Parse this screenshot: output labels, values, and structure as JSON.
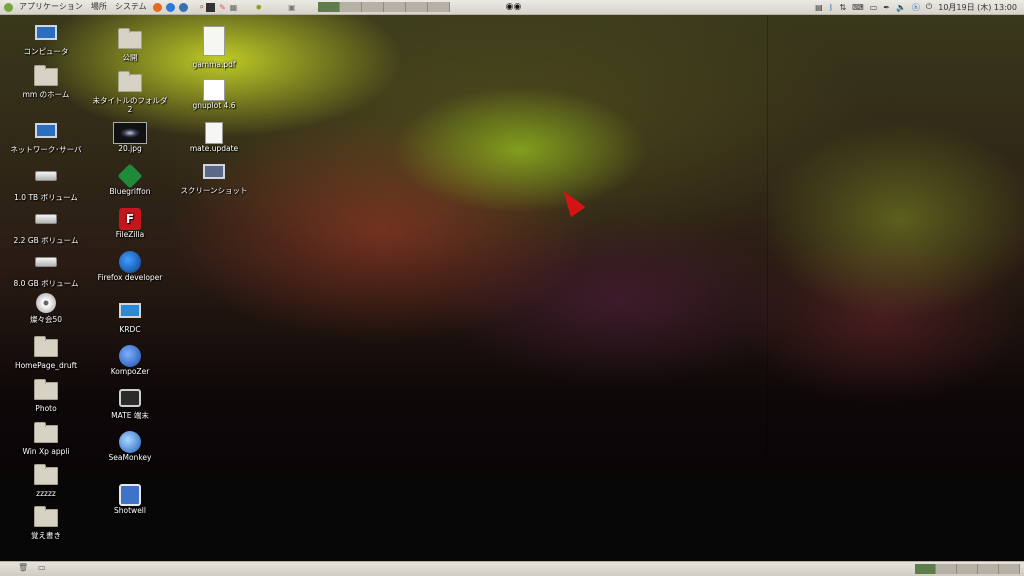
{
  "top_panel": {
    "menus": [
      "アプリケーション",
      "場所",
      "システム"
    ],
    "workspaces": 6,
    "active_workspace": 1,
    "clock": "10月19日 (木) 13:00"
  },
  "desktop": {
    "col1": [
      {
        "label": "コンピュータ",
        "icon": "computer-icon"
      },
      {
        "label": "mm のホーム",
        "icon": "home-folder-icon"
      },
      {
        "label": "ネットワーク･サーバ",
        "icon": "network-icon"
      },
      {
        "label": "1.0 TB ボリューム",
        "icon": "drive-icon"
      },
      {
        "label": "2.2 GB ボリューム",
        "icon": "drive-icon"
      },
      {
        "label": "8.0 GB ボリューム",
        "icon": "drive-icon"
      },
      {
        "label": "燦々会50",
        "icon": "disc-icon"
      },
      {
        "label": "HomePage_druft",
        "icon": "folder-icon"
      },
      {
        "label": "Photo",
        "icon": "folder-icon"
      },
      {
        "label": "Win Xp  appli",
        "icon": "folder-icon"
      },
      {
        "label": "zzzzz",
        "icon": "folder-icon"
      },
      {
        "label": "覚え書き",
        "icon": "folder-icon"
      }
    ],
    "col2": [
      {
        "label": "公開",
        "icon": "folder-icon"
      },
      {
        "label": "未タイトルのフォルダ 2",
        "icon": "folder-icon"
      },
      {
        "label": "20.jpg",
        "icon": "image-icon"
      },
      {
        "label": "Bluegriffon",
        "icon": "bluegriffon-icon"
      },
      {
        "label": "FileZilla",
        "icon": "filezilla-icon"
      },
      {
        "label": "Firefox developer",
        "icon": "firefox-icon"
      },
      {
        "label": "KRDC",
        "icon": "krdc-icon"
      },
      {
        "label": "KompoZer",
        "icon": "kompozer-icon"
      },
      {
        "label": "MATE 端末",
        "icon": "terminal-icon"
      },
      {
        "label": "SeaMonkey",
        "icon": "seamonkey-icon"
      },
      {
        "label": "Shotwell",
        "icon": "shotwell-icon"
      }
    ],
    "col3": [
      {
        "label": "gamma.pdf",
        "icon": "pdf-icon"
      },
      {
        "label": "gnuplot 4.6",
        "icon": "gnuplot-icon"
      },
      {
        "label": "mate.update",
        "icon": "script-icon"
      },
      {
        "label": "スクリーンショット",
        "icon": "screenshot-icon"
      }
    ]
  },
  "colors": {
    "panel_bg": "#dedbd3",
    "workspace_active": "#5e7d4b",
    "cursor": "#d31414"
  }
}
